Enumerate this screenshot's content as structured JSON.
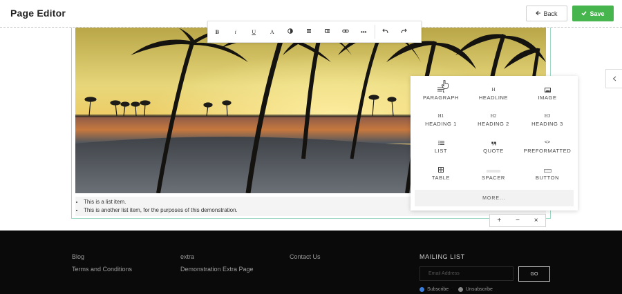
{
  "header": {
    "title": "Page Editor",
    "back_label": "Back",
    "save_label": "Save",
    "save_color": "#47b54d"
  },
  "toolbar": {
    "buttons": [
      {
        "name": "bold",
        "glyph": "B"
      },
      {
        "name": "italic",
        "glyph": "I"
      },
      {
        "name": "underline",
        "glyph": "U"
      },
      {
        "name": "font-color",
        "glyph": "A"
      },
      {
        "name": "contrast",
        "glyph": "◐"
      },
      {
        "name": "align",
        "glyph": "≡"
      },
      {
        "name": "indent",
        "glyph": "⇶"
      },
      {
        "name": "link",
        "glyph": "⛓"
      },
      {
        "name": "more",
        "glyph": "···"
      },
      {
        "name": "undo",
        "glyph": "↶"
      },
      {
        "name": "redo",
        "glyph": "↷"
      }
    ]
  },
  "content": {
    "list_items": [
      "This is a list item.",
      "This is another list item, for the purposes of this demonstration."
    ]
  },
  "block_picker": {
    "items": [
      {
        "label": "PARAGRAPH",
        "icon": "paragraph-icon"
      },
      {
        "label": "HEADLINE",
        "icon": "headline-icon",
        "glyph": "H"
      },
      {
        "label": "IMAGE",
        "icon": "image-icon"
      },
      {
        "label": "HEADING 1",
        "icon": "heading1-icon",
        "glyph": "H1"
      },
      {
        "label": "HEADING 2",
        "icon": "heading2-icon",
        "glyph": "H2"
      },
      {
        "label": "HEADING 3",
        "icon": "heading3-icon",
        "glyph": "H3"
      },
      {
        "label": "LIST",
        "icon": "list-icon"
      },
      {
        "label": "QUOTE",
        "icon": "quote-icon"
      },
      {
        "label": "PREFORMATTED",
        "icon": "code-icon",
        "glyph": "<>"
      },
      {
        "label": "TABLE",
        "icon": "table-icon"
      },
      {
        "label": "SPACER",
        "icon": "spacer-icon"
      },
      {
        "label": "BUTTON",
        "icon": "button-icon"
      }
    ],
    "more_label": "MORE..."
  },
  "block_controls": {
    "add": "+",
    "remove": "−",
    "close": "×"
  },
  "footer": {
    "col1": [
      "Blog",
      "Terms and Conditions"
    ],
    "col2": [
      "extra",
      "Demonstration Extra Page"
    ],
    "col3": [
      "Contact Us"
    ],
    "mailing_title": "MAILING LIST",
    "email_placeholder": "Email Address",
    "go_label": "GO",
    "subscribe_label": "Subscribe",
    "unsubscribe_label": "Unsubscribe",
    "subscribe_selected": true,
    "radio_active_color": "#3b7ddd"
  }
}
